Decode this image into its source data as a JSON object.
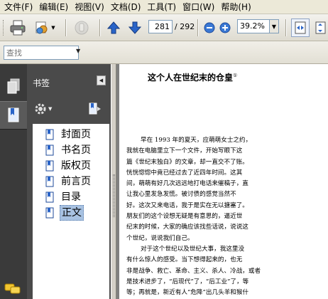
{
  "menu": [
    "文件(F)",
    "编辑(E)",
    "视图(V)",
    "文档(D)",
    "工具(T)",
    "窗口(W)",
    "帮助(H)"
  ],
  "toolbar": {
    "current_page": "281",
    "total_pages": "/ 292",
    "zoom": "39.2%"
  },
  "find": {
    "placeholder": "查找"
  },
  "sidebar": {
    "title": "书签",
    "bookmarks": [
      "封面页",
      "书名页",
      "版权页",
      "前言页",
      "目录",
      "正文"
    ],
    "selected_index": 5
  },
  "document": {
    "title": "这个人在世纪末的仓皇",
    "footnote_mark": "①",
    "paragraphs": [
      [
        "早在 1993 年的夏天，应萌萌女士之约，",
        "我就在电脑里立下一个文件，开始写眼下这",
        "篇《世纪末独白》的文章，却一直交不了账。",
        "恍恍惚惚中竟已经过去了近四年时间。这其",
        "间，萌萌有好几次远远地打电话来催稿子，直",
        "让我心里发急发慌。被讨债的感觉当然不",
        "好。这次又来电话，我于是实在无以搪塞了。",
        "朋友们的这个设想无疑是有意思的，逼近世",
        "纪末的时候，大家的确应该找些话说，说说这",
        "个世纪，说说我们自己。"
      ],
      [
        "对于这个世纪以及世纪大事，我这里没",
        "有什么惊人的感受。当下想得起来的，也无",
        "非是战争、救亡、革命、主义、杀人、冷战，或者",
        "是技术进步了，“后现代”了，“后工业”了，等",
        "等；再就是，新近有人“危降”出几头羊和猴什"
      ]
    ]
  },
  "colors": {
    "nav_dark": "#3a3a3a",
    "panel": "#4a4a4a",
    "selected_bookmark": "#a8c2e2",
    "arrow_blue": "#2a64c8"
  }
}
